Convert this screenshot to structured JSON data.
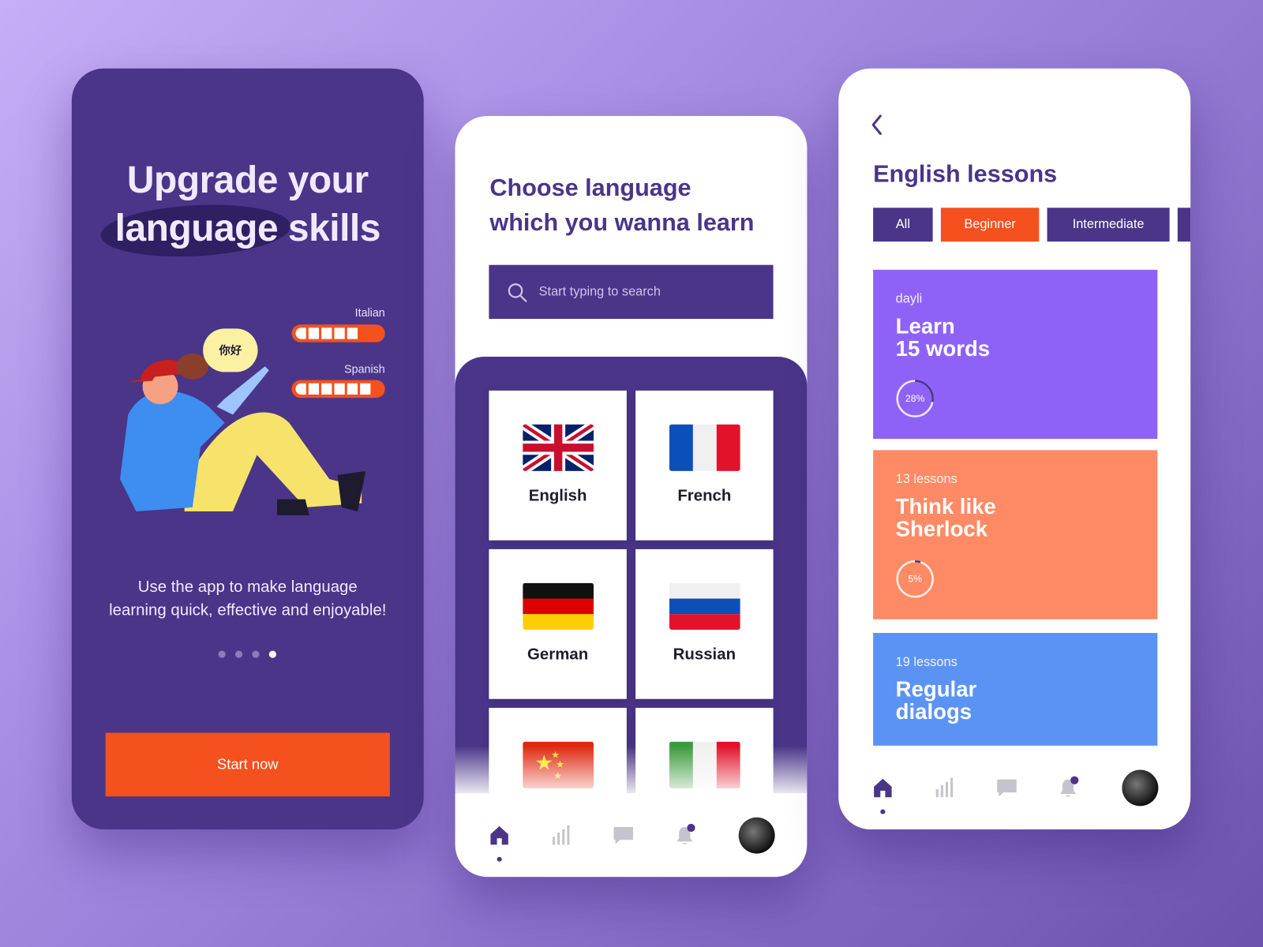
{
  "onboarding": {
    "title_line1": "Upgrade your",
    "title_line2": "language skills",
    "speech_bubble": "你好",
    "levels": [
      {
        "label": "Italian",
        "segments_filled": 5
      },
      {
        "label": "Spanish",
        "segments_filled": 6
      }
    ],
    "description_line1": "Use the app to make language",
    "description_line2": "learning quick, effective and enjoyable!",
    "pagination": {
      "total": 4,
      "active": 4
    },
    "start_button": "Start now",
    "colors": {
      "background": "#4a3589",
      "accent": "#f4511e"
    }
  },
  "choose_language": {
    "title_line1": "Choose language",
    "title_line2": "which you wanna learn",
    "search_placeholder": "Start typing to search",
    "languages": [
      {
        "label": "English",
        "flag": "uk-flag"
      },
      {
        "label": "French",
        "flag": "france-flag"
      },
      {
        "label": "German",
        "flag": "germany-flag"
      },
      {
        "label": "Russian",
        "flag": "russia-flag"
      },
      {
        "label": "",
        "flag": "china-flag"
      },
      {
        "label": "",
        "flag": "italy-flag"
      }
    ],
    "nav": [
      "home-icon",
      "stats-icon",
      "chat-icon",
      "bell-icon",
      "avatar"
    ]
  },
  "lessons": {
    "title": "English lessons",
    "filters": [
      {
        "label": "All",
        "active": false
      },
      {
        "label": "Beginner",
        "active": true
      },
      {
        "label": "Intermediate",
        "active": false
      }
    ],
    "cards": [
      {
        "subtitle": "dayli",
        "title_line1": "Learn",
        "title_line2": "15 words",
        "progress": 28,
        "progress_label": "28%",
        "color": "#8f62f7"
      },
      {
        "subtitle": "13 lessons",
        "title_line1": "Think like",
        "title_line2": "Sherlock",
        "progress": 5,
        "progress_label": "5%",
        "color": "#ff8a65"
      },
      {
        "subtitle": "19 lessons",
        "title_line1": "Regular",
        "title_line2": "dialogs",
        "progress": null,
        "progress_label": "",
        "color": "#5b93f5"
      }
    ],
    "nav": [
      "home-icon",
      "stats-icon",
      "chat-icon",
      "bell-icon",
      "avatar"
    ]
  }
}
